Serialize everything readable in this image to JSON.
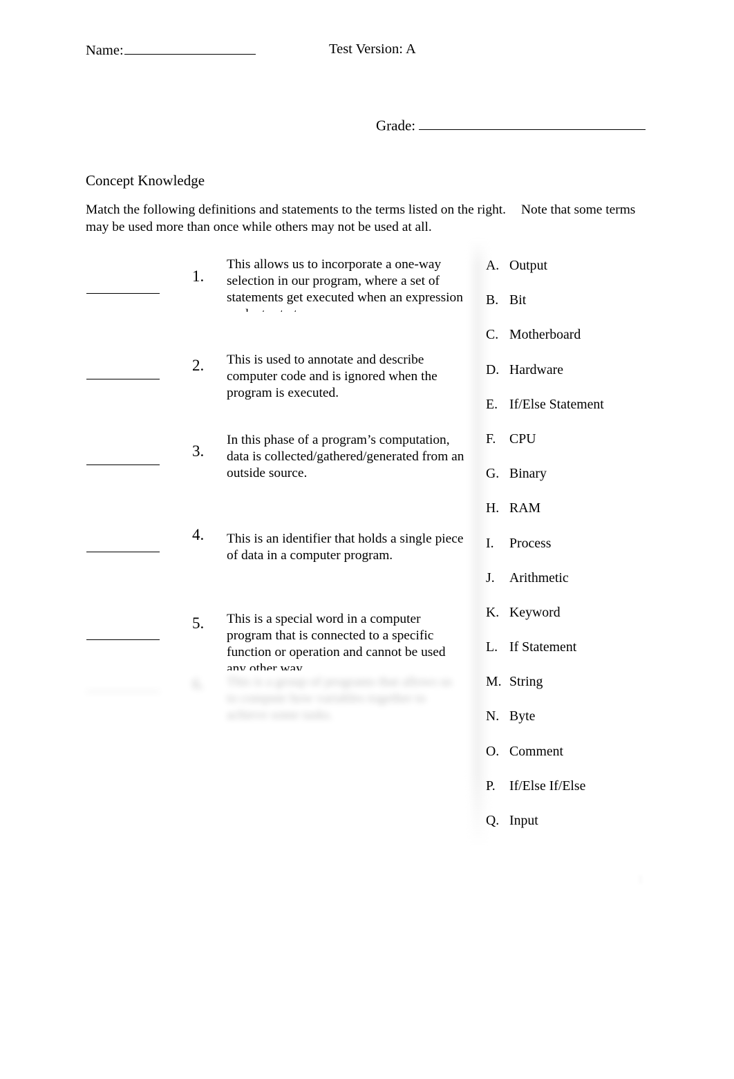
{
  "header": {
    "name_label": "Name:",
    "test_version_label": "Test Version: A",
    "grade_label": "Grade:"
  },
  "section": {
    "title": "Concept Knowledge",
    "instructions_part1": "Match the following definitions and statements to the terms listed on the right.",
    "instructions_part2": "Note that some terms may be used more than once while others may not be used at all."
  },
  "definitions": [
    {
      "number": "1.",
      "text": "This allows us to incorporate a one-way selection in our program, where a set of statements get executed when an expression evaluates to true."
    },
    {
      "number": "2.",
      "text": "This is used to annotate and describe computer code and is ignored when the program is executed."
    },
    {
      "number": "3.",
      "text": "In this phase of a program’s computation, data is collected/gathered/generated from an outside source."
    },
    {
      "number": "4.",
      "text": "This is an identifier that holds a single piece of data in a computer program."
    },
    {
      "number": "5.",
      "text": "This is a special word in a computer program that is connected to a specific function or operation and cannot be used any other way."
    },
    {
      "number": "6.",
      "text": "This is a group of programs that allows us to compute how variables together to achieve some tasks."
    }
  ],
  "terms": [
    {
      "letter": "A.",
      "label": "Output"
    },
    {
      "letter": "B.",
      "label": "Bit"
    },
    {
      "letter": "C.",
      "label": "Motherboard"
    },
    {
      "letter": "D.",
      "label": "Hardware"
    },
    {
      "letter": "E.",
      "label": "If/Else Statement"
    },
    {
      "letter": "F.",
      "label": "CPU"
    },
    {
      "letter": "G.",
      "label": "Binary"
    },
    {
      "letter": "H.",
      "label": "RAM"
    },
    {
      "letter": "I.",
      "label": "Process"
    },
    {
      "letter": "J.",
      "label": "Arithmetic"
    },
    {
      "letter": "K.",
      "label": "Keyword"
    },
    {
      "letter": "L.",
      "label": "If Statement"
    },
    {
      "letter": "M.",
      "label": "String"
    },
    {
      "letter": "N.",
      "label": "Byte"
    },
    {
      "letter": "O.",
      "label": "Comment"
    },
    {
      "letter": "P.",
      "label": "If/Else If/Else"
    },
    {
      "letter": "Q.",
      "label": "Input"
    }
  ],
  "footer": {
    "page_number": "1"
  }
}
